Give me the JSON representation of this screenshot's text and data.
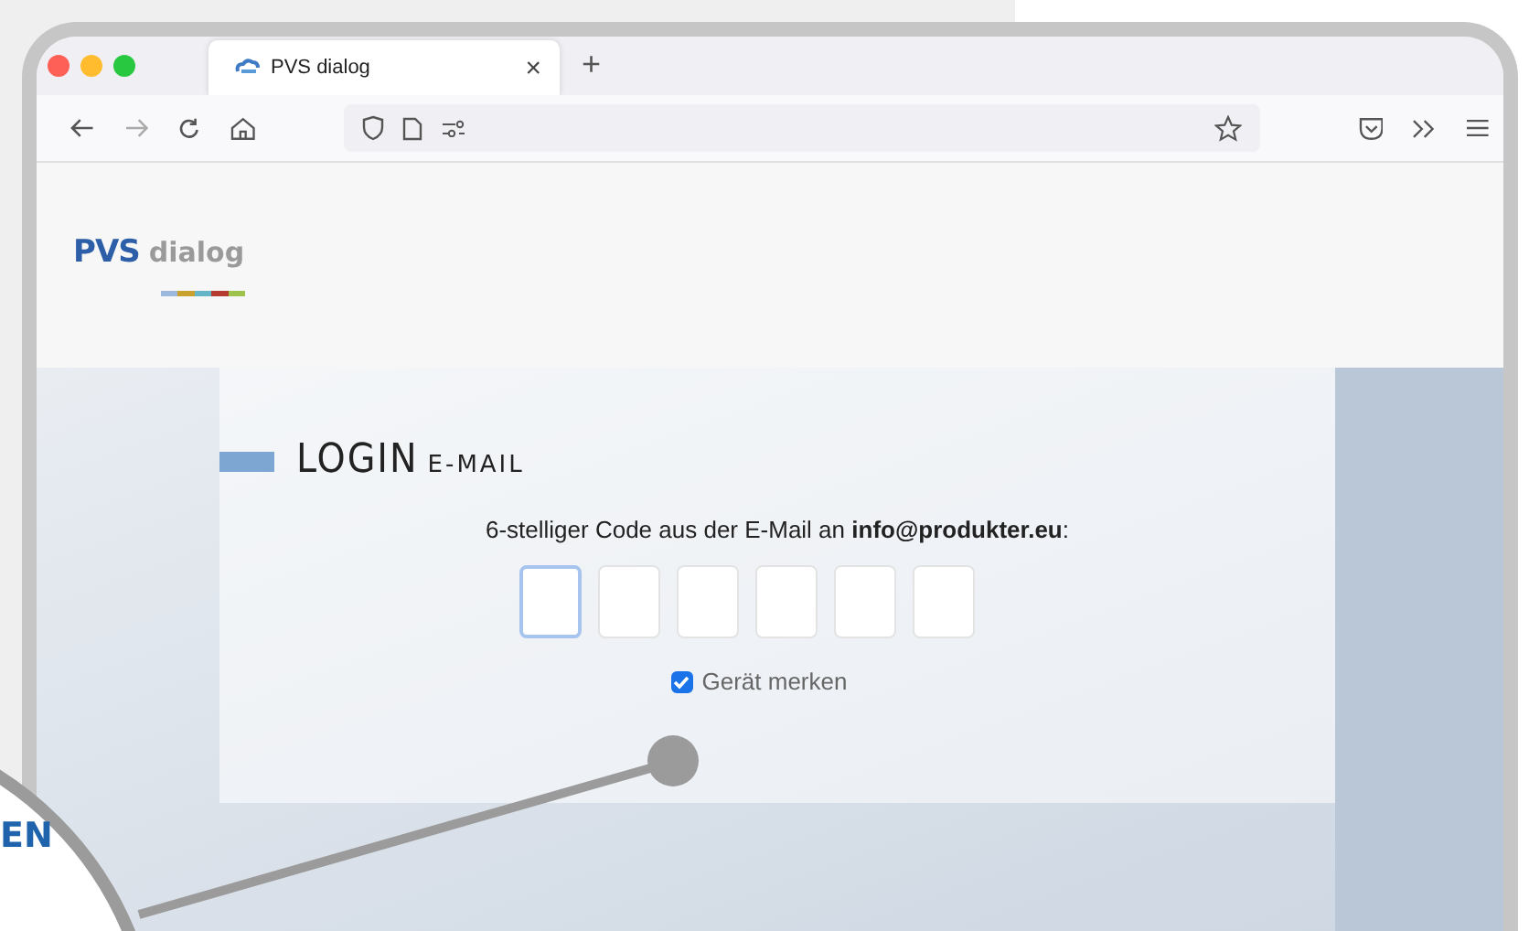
{
  "browser": {
    "tab": {
      "title": "PVS dialog",
      "close": "×",
      "selected": true
    },
    "new_tab": "+"
  },
  "page": {
    "logo": {
      "brand": "PVS",
      "product": "dialog"
    },
    "login": {
      "title": "LOGIN",
      "subtitle": "E-MAIL",
      "instruction": "6-stelliger Code aus der E-Mail an **info@produkter.eu**:",
      "code_fields": [
        {
          "focused": true
        },
        {
          "focused": false
        },
        {
          "focused": false
        },
        {
          "focused": false
        },
        {
          "focused": false
        },
        {
          "focused": false
        }
      ],
      "remember": {
        "label": "Gerät merken",
        "checked": true
      }
    }
  },
  "callout": {
    "text": "EN"
  }
}
